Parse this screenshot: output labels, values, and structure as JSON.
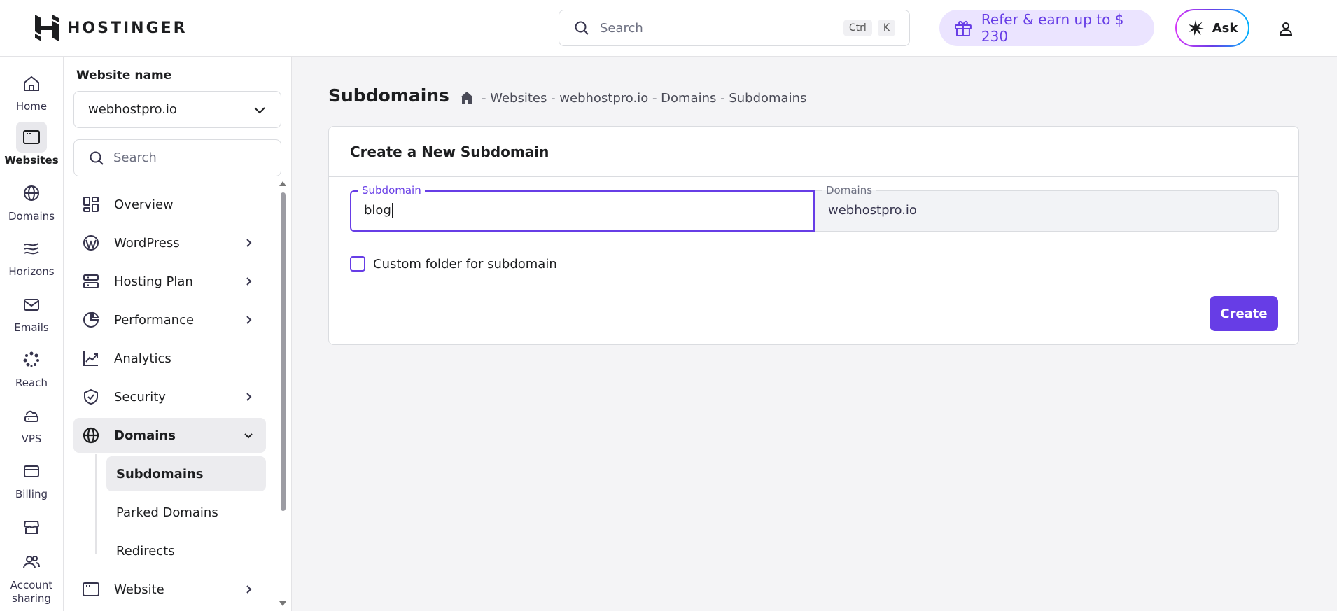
{
  "topbar": {
    "brand": "HOSTINGER",
    "search_placeholder": "Search",
    "shortcut_ctrl": "Ctrl",
    "shortcut_key": "K",
    "refer_label": "Refer & earn up to $ 230",
    "ask_label": "Ask"
  },
  "rail": {
    "items": [
      {
        "label": "Home",
        "icon": "home-icon"
      },
      {
        "label": "Websites",
        "icon": "browser-icon"
      },
      {
        "label": "Domains",
        "icon": "globe-icon"
      },
      {
        "label": "Horizons",
        "icon": "horizons-icon"
      },
      {
        "label": "Emails",
        "icon": "mail-icon"
      },
      {
        "label": "Reach",
        "icon": "reach-icon"
      },
      {
        "label": "VPS",
        "icon": "cloud-server-icon"
      },
      {
        "label": "Billing",
        "icon": "credit-card-icon"
      },
      {
        "label": "",
        "icon": "store-icon"
      },
      {
        "label": "Account sharing",
        "icon": "users-icon"
      }
    ]
  },
  "sidebar": {
    "site_name_label": "Website name",
    "site_selected": "webhostpro.io",
    "search_placeholder": "Search",
    "nav": [
      {
        "label": "Overview",
        "icon": "overview-icon"
      },
      {
        "label": "WordPress",
        "icon": "wordpress-icon"
      },
      {
        "label": "Hosting Plan",
        "icon": "server-icon"
      },
      {
        "label": "Performance",
        "icon": "pie-chart-icon"
      },
      {
        "label": "Analytics",
        "icon": "trend-icon"
      },
      {
        "label": "Security",
        "icon": "shield-icon"
      },
      {
        "label": "Domains",
        "icon": "globe-icon"
      },
      {
        "label": "Website",
        "icon": "browser-icon"
      }
    ],
    "sub": [
      {
        "label": "Subdomains"
      },
      {
        "label": "Parked Domains"
      },
      {
        "label": "Redirects"
      }
    ]
  },
  "main": {
    "title": "Subdomains",
    "breadcrumb": "- Websites - webhostpro.io - Domains - Subdomains",
    "card_title": "Create a New Subdomain",
    "subdomain_label": "Subdomain",
    "subdomain_value": "blog",
    "domains_label": "Domains",
    "domains_value": "webhostpro.io",
    "custom_folder_label": "Custom folder for subdomain",
    "create_label": "Create"
  },
  "colors": {
    "accent": "#673de6",
    "refer_bg": "#ebe4ff"
  }
}
